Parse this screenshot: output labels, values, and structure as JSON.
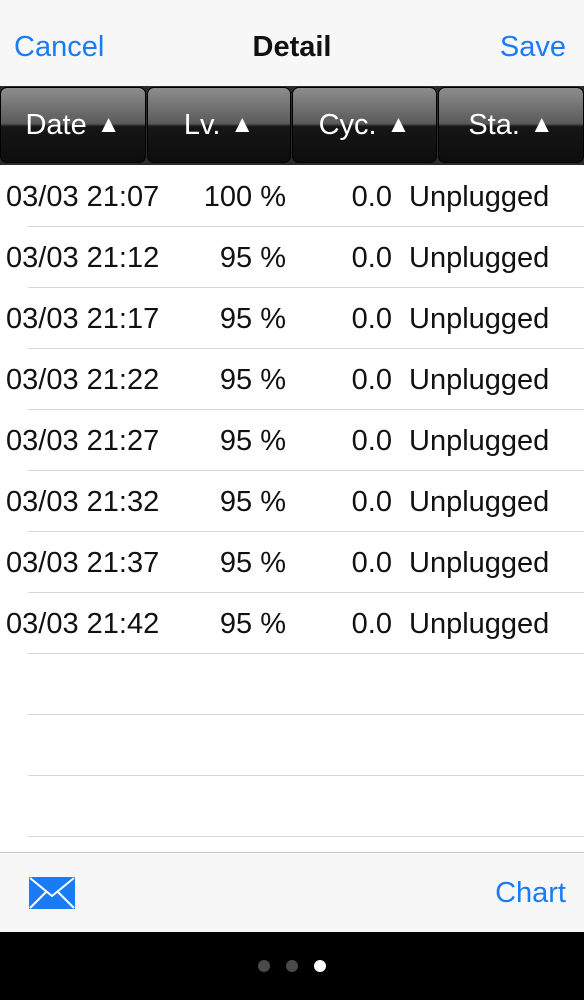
{
  "navbar": {
    "cancel_label": "Cancel",
    "title": "Detail",
    "save_label": "Save"
  },
  "columns": [
    {
      "label": "Date",
      "arrow": "▲"
    },
    {
      "label": "Lv.",
      "arrow": "▲"
    },
    {
      "label": "Cyc.",
      "arrow": "▲"
    },
    {
      "label": "Sta.",
      "arrow": "▲"
    }
  ],
  "rows": [
    {
      "date": "03/03 21:07",
      "level": "100 %",
      "cycle": "0.0",
      "status": "Unplugged"
    },
    {
      "date": "03/03 21:12",
      "level": "95 %",
      "cycle": "0.0",
      "status": "Unplugged"
    },
    {
      "date": "03/03 21:17",
      "level": "95 %",
      "cycle": "0.0",
      "status": "Unplugged"
    },
    {
      "date": "03/03 21:22",
      "level": "95 %",
      "cycle": "0.0",
      "status": "Unplugged"
    },
    {
      "date": "03/03 21:27",
      "level": "95 %",
      "cycle": "0.0",
      "status": "Unplugged"
    },
    {
      "date": "03/03 21:32",
      "level": "95 %",
      "cycle": "0.0",
      "status": "Unplugged"
    },
    {
      "date": "03/03 21:37",
      "level": "95 %",
      "cycle": "0.0",
      "status": "Unplugged"
    },
    {
      "date": "03/03 21:42",
      "level": "95 %",
      "cycle": "0.0",
      "status": "Unplugged"
    }
  ],
  "toolbar": {
    "mail_icon": "envelope-icon",
    "chart_label": "Chart"
  },
  "pager": {
    "page_count": 3,
    "current_page": 3
  },
  "colors": {
    "accent": "#1a7cf5",
    "header_dark": "#161616",
    "separator": "#d6d6d6"
  }
}
